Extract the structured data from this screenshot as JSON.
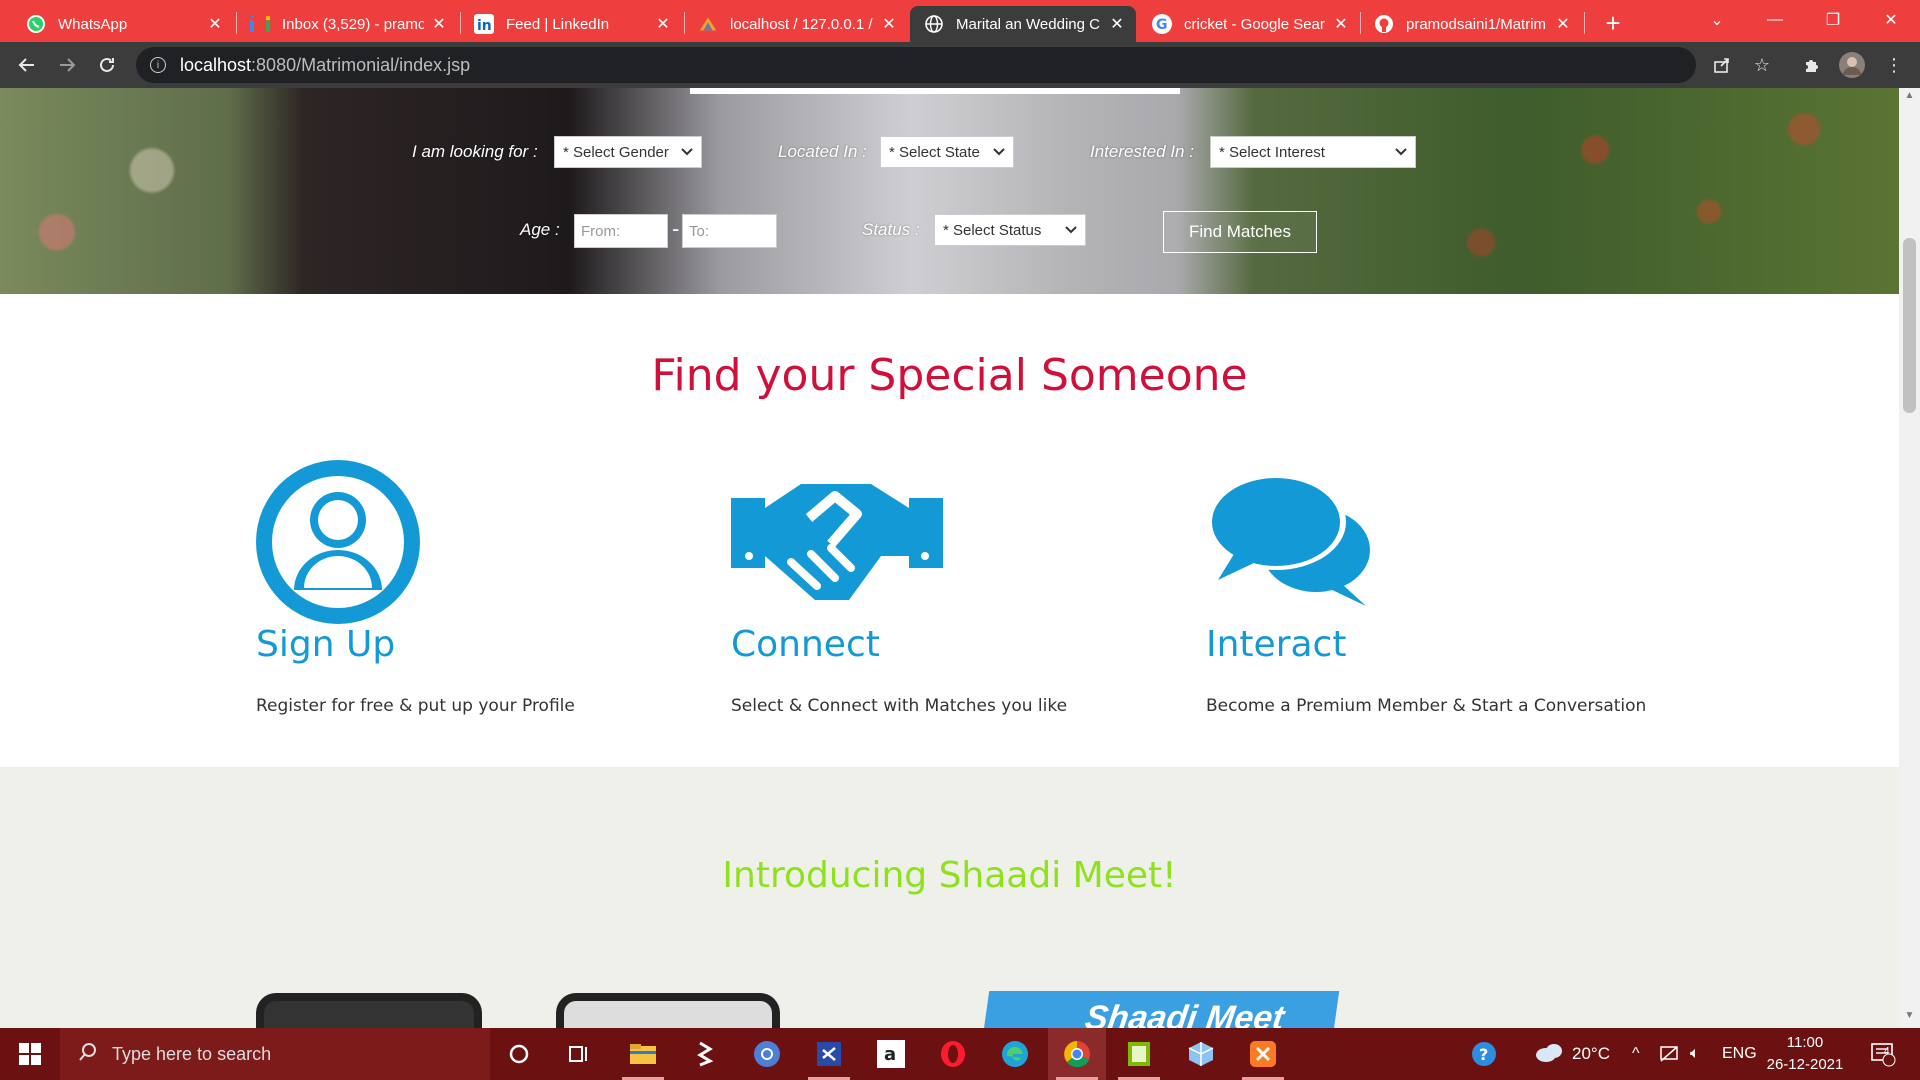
{
  "browser": {
    "tabs": [
      {
        "title": "WhatsApp",
        "icon": "whatsapp-icon",
        "active": false
      },
      {
        "title": "Inbox (3,529) - pramo",
        "icon": "gmail-icon",
        "active": false
      },
      {
        "title": "Feed | LinkedIn",
        "icon": "linkedin-icon",
        "active": false
      },
      {
        "title": "localhost / 127.0.0.1 /",
        "icon": "phpmyadmin-icon",
        "active": false
      },
      {
        "title": "Marital an Wedding C",
        "icon": "globe-icon",
        "active": true
      },
      {
        "title": "cricket - Google Sear",
        "icon": "google-icon",
        "active": false
      },
      {
        "title": "pramodsaini1/Matrim",
        "icon": "github-icon",
        "active": false
      }
    ],
    "new_tab": "+",
    "url_host": "localhost",
    "url_rest": ":8080/Matrimonial/index.jsp"
  },
  "search_form": {
    "looking_for_label": "I am looking for :",
    "gender_select": "* Select Gender",
    "located_label": "Located In :",
    "state_select": "* Select State",
    "interested_label": "Interested In :",
    "interest_select": "* Select Interest",
    "age_label": "Age :",
    "age_from_placeholder": "From:",
    "age_separator": "-",
    "age_to_placeholder": "To:",
    "status_label": "Status :",
    "status_select": "* Select Status",
    "find_button": "Find Matches"
  },
  "main": {
    "headline": "Find your Special Someone",
    "features": [
      {
        "icon": "user-profile-icon",
        "title": "Sign Up",
        "description": "Register for free & put up your Profile"
      },
      {
        "icon": "handshake-icon",
        "title": "Connect",
        "description": "Select & Connect with Matches you like"
      },
      {
        "icon": "chat-bubbles-icon",
        "title": "Interact",
        "description": "Become a Premium Member & Start a Conversation"
      }
    ],
    "intro_title": "Introducing Shaadi Meet!",
    "banner_text": "Shaadi Meet"
  },
  "colors": {
    "tab_strip": "#ef3e3e",
    "headline": "#d0103a",
    "feature_blue": "#139ad6",
    "intro_green": "#8ee21c",
    "taskbar": "#6b1111"
  },
  "taskbar": {
    "search_placeholder": "Type here to search",
    "apps": [
      "cortana-icon",
      "task-view-icon",
      "file-explorer-icon",
      "sublime-icon",
      "chromium-icon",
      "visual-studio-icon",
      "amazon-icon",
      "opera-icon",
      "edge-icon",
      "chrome-icon",
      "notepad-icon",
      "virtualbox-icon",
      "xampp-icon"
    ],
    "weather": "20°C",
    "language": "ENG",
    "time": "11:00",
    "date": "26-12-2021",
    "notification_count": "4"
  }
}
